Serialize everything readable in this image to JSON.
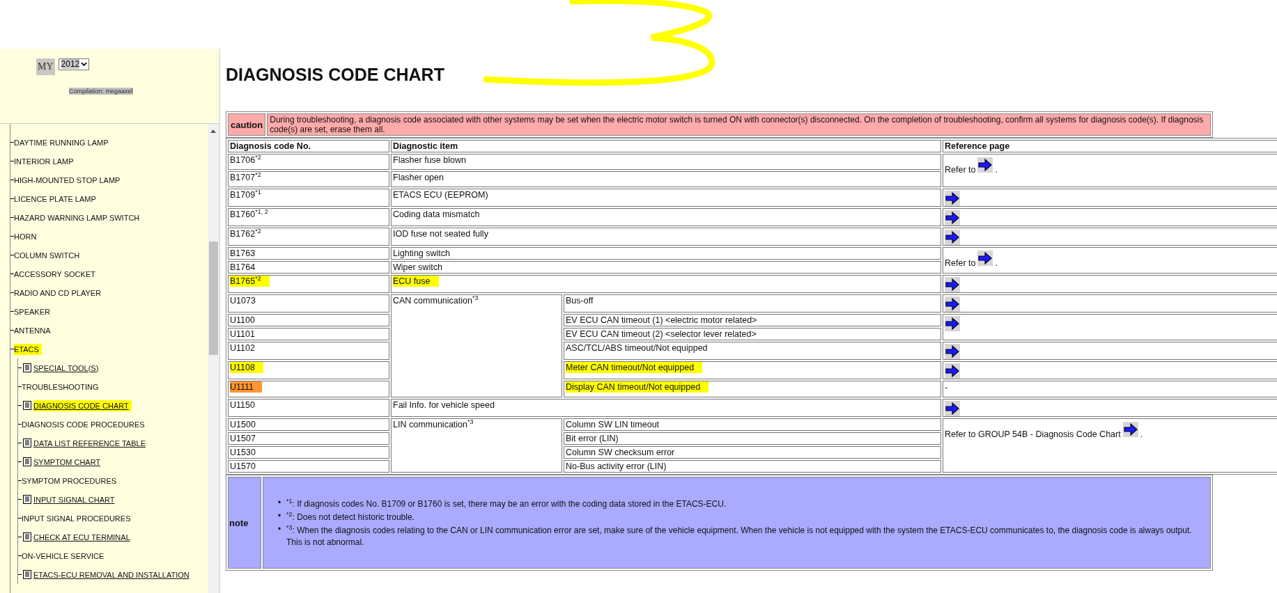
{
  "sidebar": {
    "model_year": {
      "label": "MY",
      "value": "2012"
    },
    "compilation": "Compilation: megaaxel",
    "tree": [
      {
        "label": "DAYTIME RUNNING LAMP",
        "highlighted": false
      },
      {
        "label": "INTERIOR LAMP",
        "highlighted": false
      },
      {
        "label": "HIGH-MOUNTED STOP LAMP",
        "highlighted": false
      },
      {
        "label": "LICENCE PLATE LAMP",
        "highlighted": false
      },
      {
        "label": "HAZARD WARNING LAMP SWITCH",
        "highlighted": false
      },
      {
        "label": "HORN",
        "highlighted": false
      },
      {
        "label": "COLUMN SWITCH",
        "highlighted": false
      },
      {
        "label": "ACCESSORY SOCKET",
        "highlighted": false
      },
      {
        "label": "RADIO AND CD PLAYER",
        "highlighted": false
      },
      {
        "label": "SPEAKER",
        "highlighted": false
      },
      {
        "label": "ANTENNA",
        "highlighted": false
      },
      {
        "label": "ETACS",
        "highlighted": true,
        "children": [
          {
            "label": "SPECIAL TOOL(S)",
            "kind": "doc",
            "highlighted": false
          },
          {
            "label": "TROUBLESHOOTING",
            "kind": "text",
            "highlighted": false
          },
          {
            "label": "DIAGNOSIS CODE CHART",
            "kind": "doc",
            "highlighted": true
          },
          {
            "label": "DIAGNOSIS CODE PROCEDURES",
            "kind": "text",
            "highlighted": false
          },
          {
            "label": "DATA LIST REFERENCE TABLE",
            "kind": "doc",
            "highlighted": false
          },
          {
            "label": "SYMPTOM CHART",
            "kind": "doc",
            "highlighted": false
          },
          {
            "label": "SYMPTOM PROCEDURES",
            "kind": "text",
            "highlighted": false
          },
          {
            "label": "INPUT SIGNAL CHART",
            "kind": "doc",
            "highlighted": false
          },
          {
            "label": "INPUT SIGNAL PROCEDURES",
            "kind": "text",
            "highlighted": false
          },
          {
            "label": "CHECK AT ECU TERMINAL",
            "kind": "doc",
            "highlighted": false
          },
          {
            "label": "ON-VEHICLE SERVICE",
            "kind": "text",
            "highlighted": false
          },
          {
            "label": "ETACS-ECU REMOVAL AND INSTALLATION",
            "kind": "doc",
            "highlighted": false
          }
        ]
      }
    ]
  },
  "page": {
    "title": "DIAGNOSIS CODE CHART",
    "caution": {
      "label": "caution",
      "text": "During troubleshooting, a diagnosis code associated with other systems may be set when the electric motor switch is turned ON with connector(s) disconnected. On the completion of troubleshooting, confirm all systems for diagnosis code(s). If diagnosis code(s) are set, erase them all."
    },
    "table": {
      "columns": [
        "Diagnosis code No.",
        "Diagnostic item",
        "Reference page"
      ],
      "sections": [
        {
          "refs": [
            {
              "ref": {
                "kind": "refer",
                "text": "Refer to",
                "tail": "."
              },
              "rows": [
                {
                  "code": "B1706$^{*2}$",
                  "item": "Flasher fuse blown"
                },
                {
                  "code": "B1707$^{*2}$",
                  "item": "Flasher open"
                }
              ]
            },
            {
              "ref": {
                "kind": "link"
              },
              "rows": [
                {
                  "code": "B1709$^{*1}$",
                  "item": "ETACS ECU (EEPROM)"
                }
              ]
            },
            {
              "ref": {
                "kind": "link"
              },
              "rows": [
                {
                  "code": "B1760$^{*1, 2}$",
                  "item": "Coding data mismatch"
                }
              ]
            },
            {
              "ref": {
                "kind": "link"
              },
              "rows": [
                {
                  "code": "B1762$^{*2}$",
                  "item": "IOD fuse not seated fully"
                }
              ]
            },
            {
              "ref": {
                "kind": "refer",
                "text": "Refer to",
                "tail": "."
              },
              "rows": [
                {
                  "code": "B1763",
                  "item": "Lighting switch"
                },
                {
                  "code": "B1764",
                  "item": "Wiper switch"
                }
              ]
            },
            {
              "ref": {
                "kind": "link"
              },
              "rows": [
                {
                  "code": "B1765$^{*2}$",
                  "code_mark": {
                    "color": "#ffff00"
                  },
                  "item": "ECU fuse",
                  "item_mark": {
                    "color": "#ffff00"
                  }
                }
              ]
            }
          ]
        },
        {
          "item": "CAN communication$^{*3}$",
          "refs": [
            {
              "ref": {
                "kind": "link"
              },
              "rows": [
                {
                  "code": "U1073",
                  "item": "Bus-off"
                }
              ]
            },
            {
              "ref": {
                "kind": "link"
              },
              "rows": [
                {
                  "code": "U1100",
                  "item": "EV ECU CAN timeout (1) <electric motor related>"
                },
                {
                  "code": "U1101",
                  "item": "EV ECU CAN timeout (2) <selector lever related>"
                }
              ]
            },
            {
              "ref": {
                "kind": "link"
              },
              "rows": [
                {
                  "code": "U1102",
                  "item": "ASC/TCL/ABS timeout/Not equipped"
                }
              ]
            },
            {
              "ref": {
                "kind": "link"
              },
              "rows": [
                {
                  "code": "U1108",
                  "code_mark": {
                    "color": "#ffff00"
                  },
                  "item": "Meter CAN timeout/Not equipped",
                  "item_mark": {
                    "color": "#ffff00"
                  }
                }
              ]
            },
            {
              "ref": {
                "kind": "text",
                "text": "-"
              },
              "rows": [
                {
                  "code": "U1111",
                  "code_mark": {
                    "color": "#ff9632"
                  },
                  "item": "Display CAN timeout/Not equipped",
                  "item_mark": {
                    "color": "#ffff00"
                  }
                }
              ]
            }
          ]
        },
        {
          "refs": [
            {
              "ref": {
                "kind": "link"
              },
              "rows": [
                {
                  "code": "U1150",
                  "item": "Fail Info. for vehicle speed"
                }
              ]
            }
          ]
        },
        {
          "item": "LIN communication$^{*3}$",
          "refs": [
            {
              "ref": {
                "kind": "refer",
                "text": "Refer to GROUP 54B - Diagnosis Code Chart",
                "tail": "."
              },
              "rows": [
                {
                  "code": "U1500",
                  "item": "Column SW LIN timeout"
                },
                {
                  "code": "U1507",
                  "item": "Bit error (LIN)"
                },
                {
                  "code": "U1530",
                  "item": "Column SW checksum error"
                },
                {
                  "code": "U1570",
                  "item": "No-Bus activity error (LIN)"
                }
              ]
            }
          ]
        }
      ]
    },
    "note": {
      "label": "note",
      "items": [
        {
          "marker": "•",
          "text": "$^{*1}$: If diagnosis codes No. B1709 or B1760 is set, there may be an error with the coding data stored in the ETACS-ECU."
        },
        {
          "marker": "•",
          "text": "$^{*2}$: Does not detect historic trouble."
        },
        {
          "marker": "•",
          "text": "$^{*3}$: When the diagnosis codes relating to the CAN or LIN communication error are set, make sure of the vehicle equipment. When the vehicle is not equipped with the system the ETACS-ECU communicates to, the diagnosis code is always output. This is not abnormal."
        }
      ]
    }
  }
}
